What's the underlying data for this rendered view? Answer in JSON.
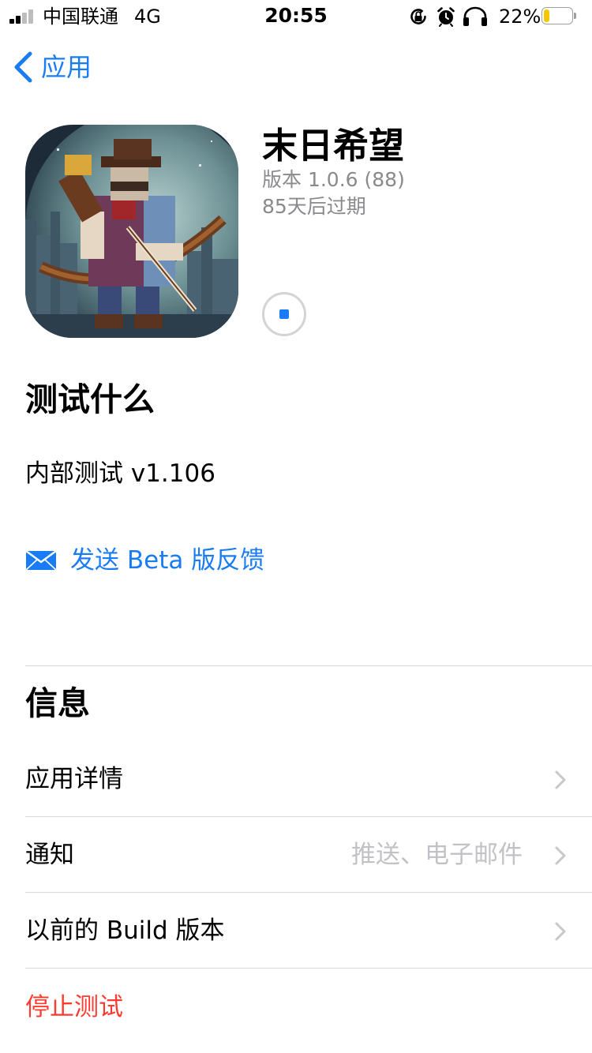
{
  "status_bar": {
    "carrier": "中国联通",
    "network": "4G",
    "time": "20:55",
    "battery_percent": "22%",
    "battery_level": 0.22,
    "signal_bars": 2,
    "icons": [
      "orientation-lock-icon",
      "alarm-icon",
      "headphones-icon",
      "battery-icon"
    ]
  },
  "nav": {
    "back_label": "应用",
    "back_icon": "chevron-left-icon"
  },
  "app": {
    "name": "末日希望",
    "version": "版本 1.0.6 (88)",
    "expiry": "85天后过期",
    "icon": "pixel-archer-app-icon",
    "download_state_icon": "stop-download-icon"
  },
  "test_section": {
    "title": "测试什么",
    "notes": "内部测试 v1.106",
    "feedback_label": "发送 Beta 版反馈",
    "feedback_icon": "mail-icon"
  },
  "info_section": {
    "title": "信息",
    "rows": [
      {
        "label": "应用详情",
        "detail": ""
      },
      {
        "label": "通知",
        "detail": "推送、电子邮件"
      },
      {
        "label": "以前的 Build 版本",
        "detail": ""
      }
    ],
    "stop_testing_label": "停止测试"
  },
  "colors": {
    "accent": "#1a7cf5",
    "destructive": "#ff3b30",
    "secondary_text": "#8a8a8e",
    "detail_text": "#c2c2c6",
    "separator": "#d8d8d8",
    "battery_fill": "#f7c600"
  }
}
